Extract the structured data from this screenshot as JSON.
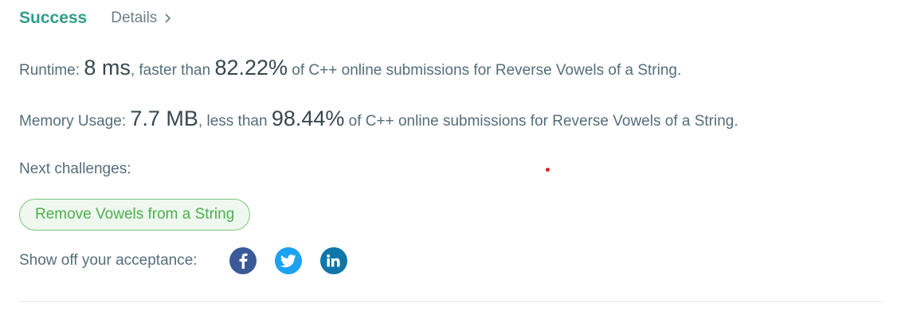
{
  "header": {
    "status": "Success",
    "details_label": "Details"
  },
  "runtime": {
    "label": "Runtime: ",
    "value": "8 ms",
    "compare_text": ", faster than ",
    "percent": "82.22%",
    "suffix": " of C++ online submissions for Reverse Vowels of a String."
  },
  "memory": {
    "label": "Memory Usage: ",
    "value": "7.7 MB",
    "compare_text": ", less than ",
    "percent": "98.44%",
    "suffix": " of C++ online submissions for Reverse Vowels of a String."
  },
  "next_challenges": {
    "label": "Next challenges:",
    "items": [
      "Remove Vowels from a String"
    ]
  },
  "share": {
    "label": "Show off your acceptance:",
    "icons": [
      {
        "name": "facebook-icon",
        "color": "#3b5998"
      },
      {
        "name": "twitter-icon",
        "color": "#1da1f2"
      },
      {
        "name": "linkedin-icon",
        "color": "#0e76a8"
      }
    ]
  },
  "colors": {
    "success": "#2e9e8a",
    "challenge_text": "#4daf4f",
    "challenge_border": "#7cc47e"
  }
}
